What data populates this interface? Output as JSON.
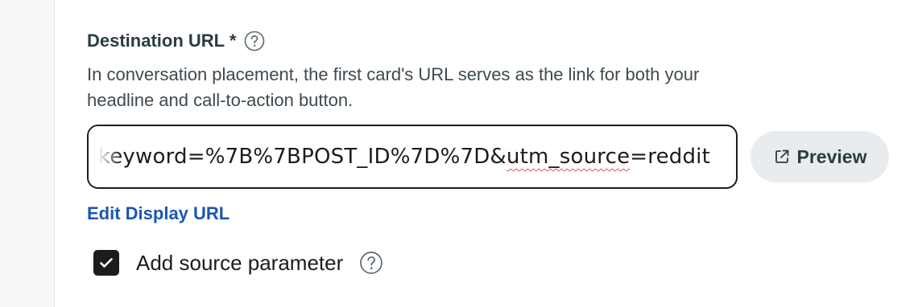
{
  "destination_url": {
    "label": "Destination URL *",
    "help_icon": "question-circle-icon",
    "description": "In conversation placement, the first card's URL serves as the link for both your headline and call-to-action button.",
    "value_prefix": "keyword=%7B%7BPOST_ID%7D%7D&",
    "value_misspelled": "utm_source",
    "value_suffix": "=reddit",
    "preview_label": "Preview",
    "preview_icon": "external-link-icon",
    "edit_display_url_label": "Edit Display URL"
  },
  "source_parameter": {
    "label": "Add source parameter",
    "checked": true,
    "help_icon": "question-circle-icon"
  },
  "colors": {
    "link": "#1b56b0",
    "checkbox_fill": "#1c1c1c",
    "preview_bg": "#e9ecee",
    "spellcheck": "#e0505a"
  }
}
